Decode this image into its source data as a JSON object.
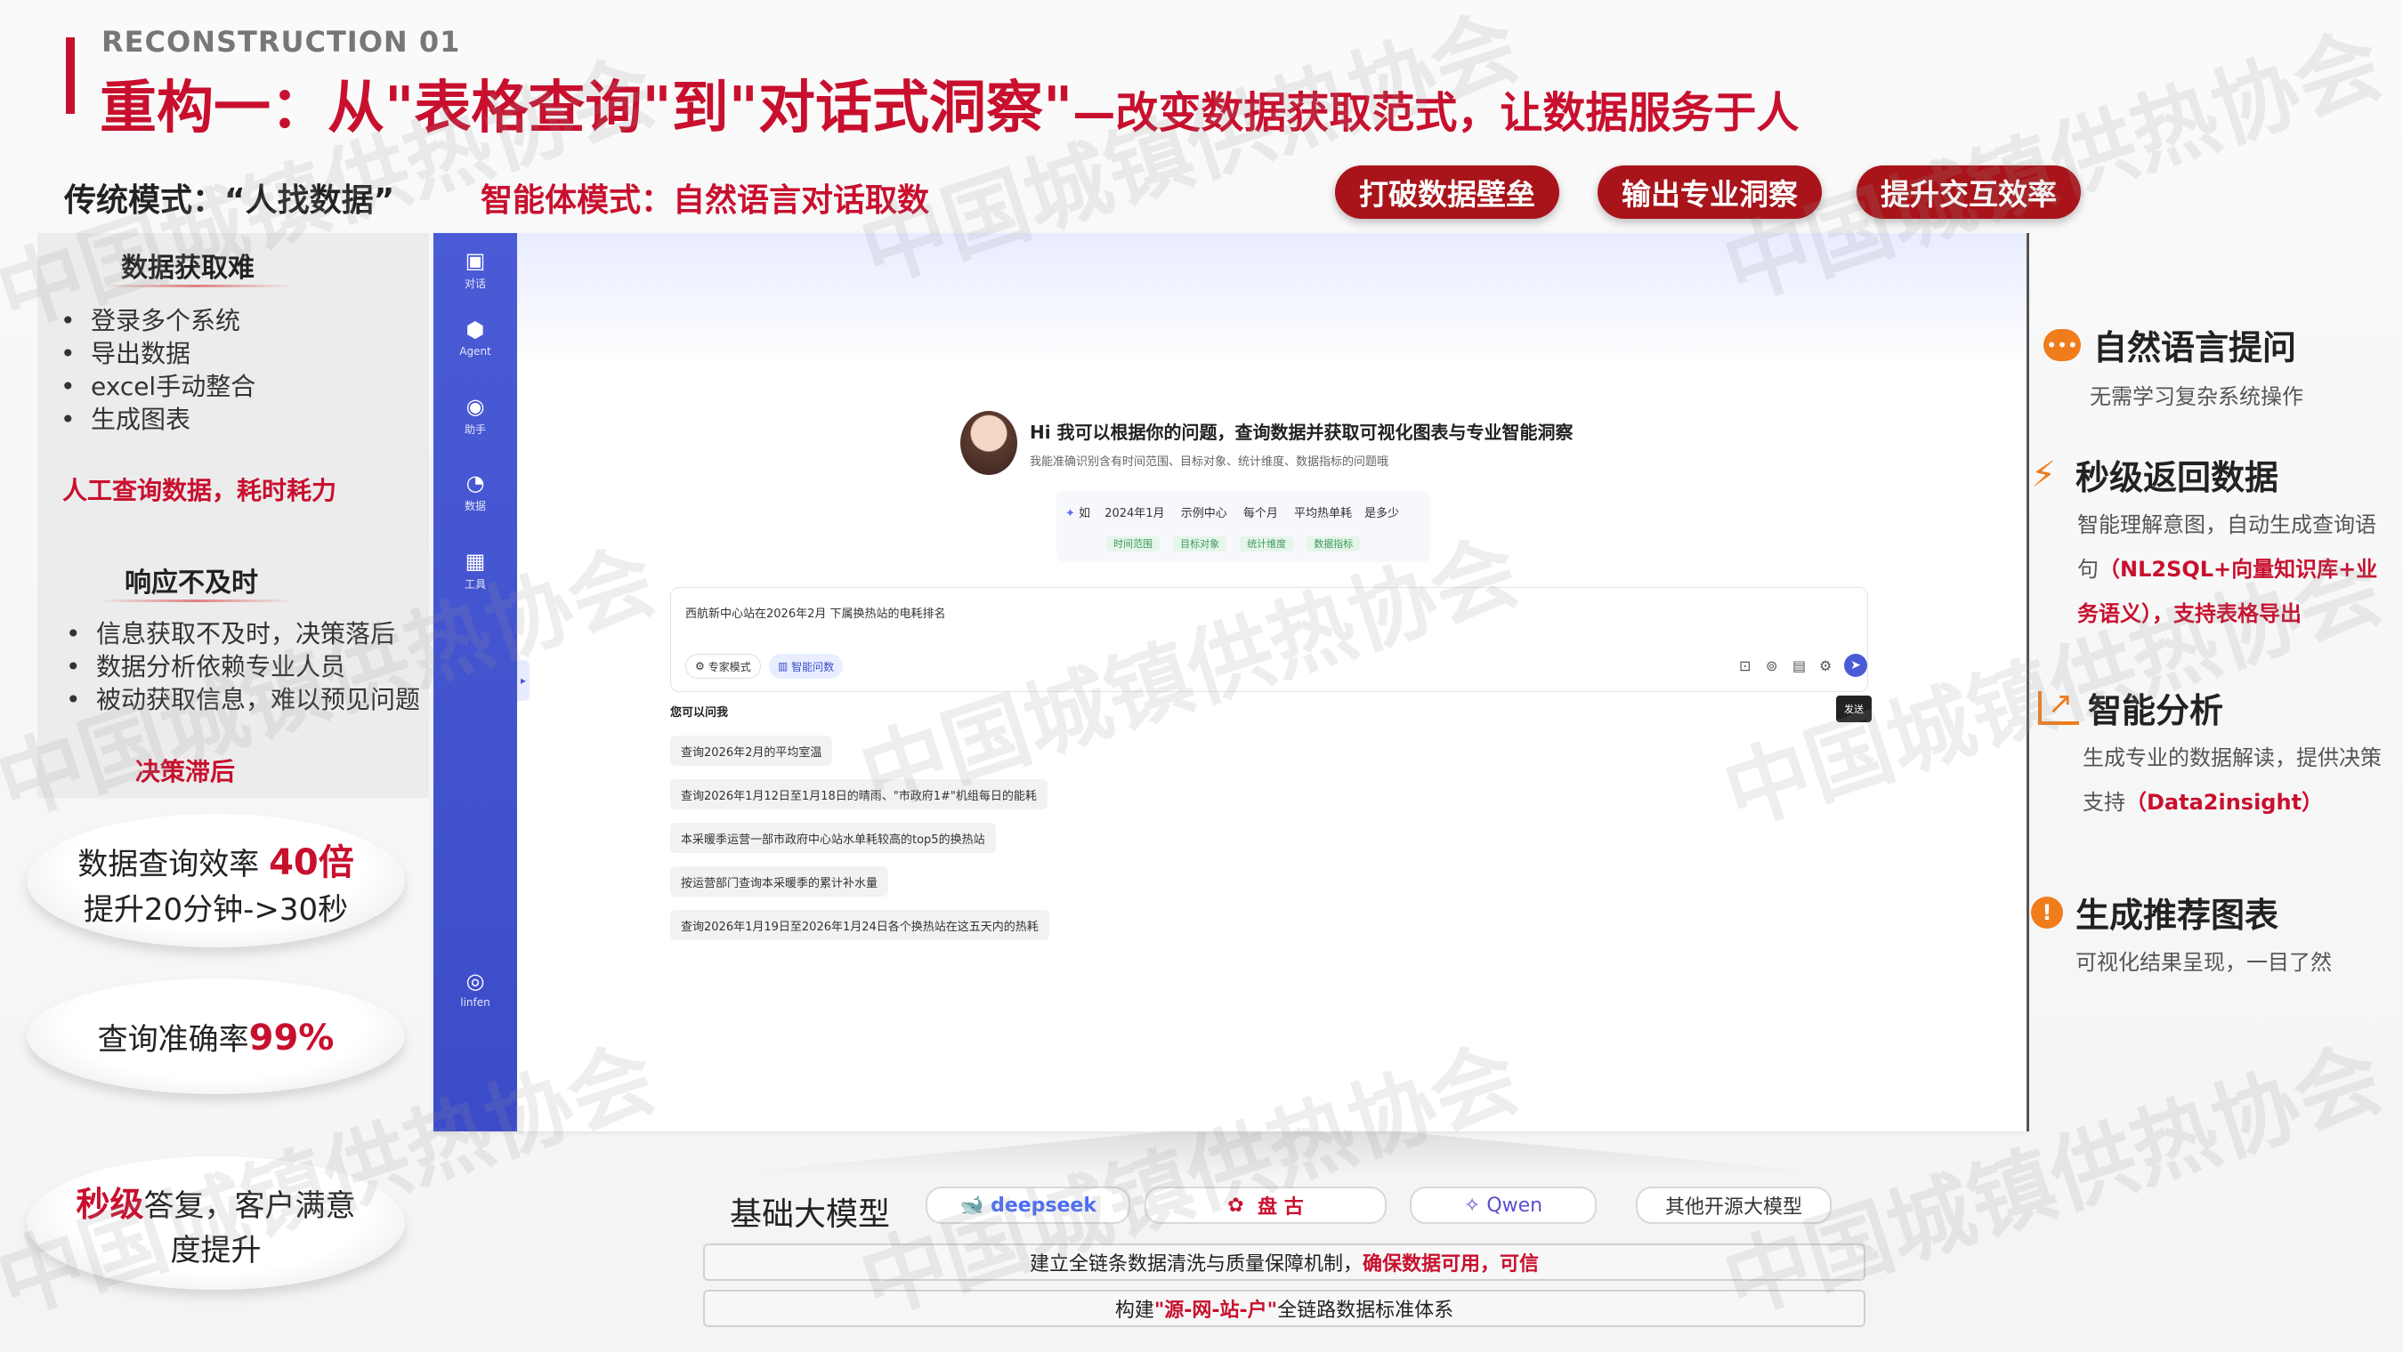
{
  "header": {
    "eyebrow": "RECONSTRUCTION 01",
    "title_main": "重构一：从\"表格查询\"到\"对话式洞察\"",
    "title_sub": "—改变数据获取范式，让数据服务于人"
  },
  "mode_row": {
    "traditional": "传统模式：“人找数据”",
    "agent": "智能体模式：自然语言对话取数",
    "pills": [
      "打破数据壁垒",
      "输出专业洞察",
      "提升交互效率"
    ]
  },
  "left": {
    "section1": {
      "heading": "数据获取难",
      "bullets": [
        "登录多个系统",
        "导出数据",
        "excel手动整合",
        "生成图表"
      ],
      "conclusion": "人工查询数据，耗时耗力"
    },
    "section2": {
      "heading": "响应不及时",
      "bullets": [
        "信息获取不及时，决策落后",
        "数据分析依赖专业人员",
        "被动获取信息，难以预见问题"
      ],
      "conclusion": "决策滞后"
    },
    "stat1": {
      "line1_prefix": "数据查询效率 ",
      "line1_value": "40倍",
      "line2": "提升20分钟->30秒"
    },
    "stat2": {
      "prefix": "查询准确率",
      "value": "99%"
    },
    "stat3": {
      "highlight": "秒级",
      "rest": "答复，客户满意",
      "line2": "度提升"
    }
  },
  "app": {
    "sidebar": [
      {
        "icon": "chat-icon",
        "glyph": "▣",
        "label": "对话"
      },
      {
        "icon": "agent-icon",
        "glyph": "⬢",
        "label": "Agent"
      },
      {
        "icon": "assistant-icon",
        "glyph": "◉",
        "label": "助手"
      },
      {
        "icon": "data-icon",
        "glyph": "◔",
        "label": "数据"
      },
      {
        "icon": "tools-icon",
        "glyph": "▦",
        "label": "工具"
      }
    ],
    "user_label": "linfen",
    "greeting": "Hi 我可以根据你的问题，查询数据并获取可视化图表与专业智能洞察",
    "greeting_sub": "我能准确识别含有时间范围、目标对象、统计维度、数据指标的问题哦",
    "example": {
      "prefix": "如",
      "parts": [
        "2024年1月",
        "示例中心",
        "每个月",
        "平均热单耗",
        "是多少"
      ],
      "tags": [
        "时间范围",
        "目标对象",
        "统计维度",
        "数据指标"
      ]
    },
    "input_text": "西航新中心站在2026年2月 下属换热站的电耗排名",
    "mode_expert": "专家模式",
    "mode_smart": "智能问数",
    "send_tooltip": "发送",
    "suggest_title": "您可以问我",
    "suggestions": [
      "查询2026年2月的平均室温",
      "查询2026年1月12日至1月18日的晴雨、\"市政府1#\"机组每日的能耗",
      "本采暖季运营一部市政府中心站水单耗较高的top5的换热站",
      "按运营部门查询本采暖季的累计补水量",
      "查询2026年1月19日至2026年1月24日各个换热站在这五天内的热耗"
    ]
  },
  "features": [
    {
      "icon": "speech-bubble-icon",
      "glyph": "💬",
      "color": "#f07c1c",
      "title": "自然语言提问",
      "desc_plain": "无需学习复杂系统操作",
      "desc_red": ""
    },
    {
      "icon": "lightning-icon",
      "glyph": "⚡",
      "color": "#f07c1c",
      "title": "秒级返回数据",
      "desc_plain": "智能理解意图，自动生成查询语句",
      "desc_red": "（NL2SQL+向量知识库+业务语义），支持表格导出"
    },
    {
      "icon": "trend-chart-icon",
      "glyph": "📈",
      "color": "#f07c1c",
      "title": "智能分析",
      "desc_plain": "生成专业的数据解读，提供决策支持",
      "desc_red": "（Data2insight）"
    },
    {
      "icon": "alert-icon",
      "glyph": "!",
      "color": "#f07c1c",
      "title": "生成推荐图表",
      "desc_plain": "可视化结果呈现，一目了然",
      "desc_red": ""
    }
  ],
  "bottom": {
    "base_label": "基础大模型",
    "models": [
      "deepseek",
      "盘 古",
      "Qwen",
      "其他开源大模型"
    ],
    "row1_plain": "建立全链条数据清洗与质量保障机制，",
    "row1_red": "确保数据可用，可信",
    "row2_prefix": "构建",
    "row2_red": "\"源-网-站-户\"",
    "row2_suffix": "全链路数据标准体系"
  },
  "watermark": "中国城镇供热协会"
}
